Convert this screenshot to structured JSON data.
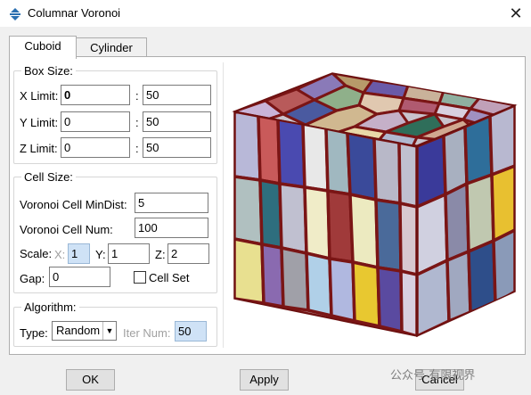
{
  "window": {
    "title": "Columnar Voronoi",
    "close_glyph": "✕"
  },
  "tabs": [
    {
      "label": "Cuboid",
      "active": true
    },
    {
      "label": "Cylinder",
      "active": false
    }
  ],
  "box_size": {
    "legend": "Box Size:",
    "x": {
      "label": "X Limit:",
      "min": "0",
      "sep": ":",
      "max": "50"
    },
    "y": {
      "label": "Y Limit:",
      "min": "0",
      "sep": ":",
      "max": "50"
    },
    "z": {
      "label": "Z Limit:",
      "min": "0",
      "sep": ":",
      "max": "50"
    }
  },
  "cell_size": {
    "legend": "Cell Size:",
    "min_dist": {
      "label": "Voronoi Cell MinDist:",
      "value": "5"
    },
    "cell_num": {
      "label": "Voronoi Cell Num:",
      "value": "100"
    },
    "scale": {
      "label": "Scale:",
      "x_label": "X:",
      "x_value": "1",
      "y_label": "Y:",
      "y_value": "1",
      "z_label": "Z:",
      "z_value": "2"
    },
    "gap": {
      "label": "Gap:",
      "value": "0"
    },
    "cell_set": {
      "label": "Cell Set",
      "checked": false
    }
  },
  "algorithm": {
    "legend": "Algorithm:",
    "type_label": "Type:",
    "type_value": "Random",
    "iter_label": "Iter Num:",
    "iter_value": "50"
  },
  "buttons": {
    "ok": "OK",
    "apply": "Apply",
    "cancel": "Cancel"
  },
  "watermark": "公众号·有限视界",
  "colors": {
    "cell_border": "#7a1515",
    "accent": "#2a6fb0"
  }
}
